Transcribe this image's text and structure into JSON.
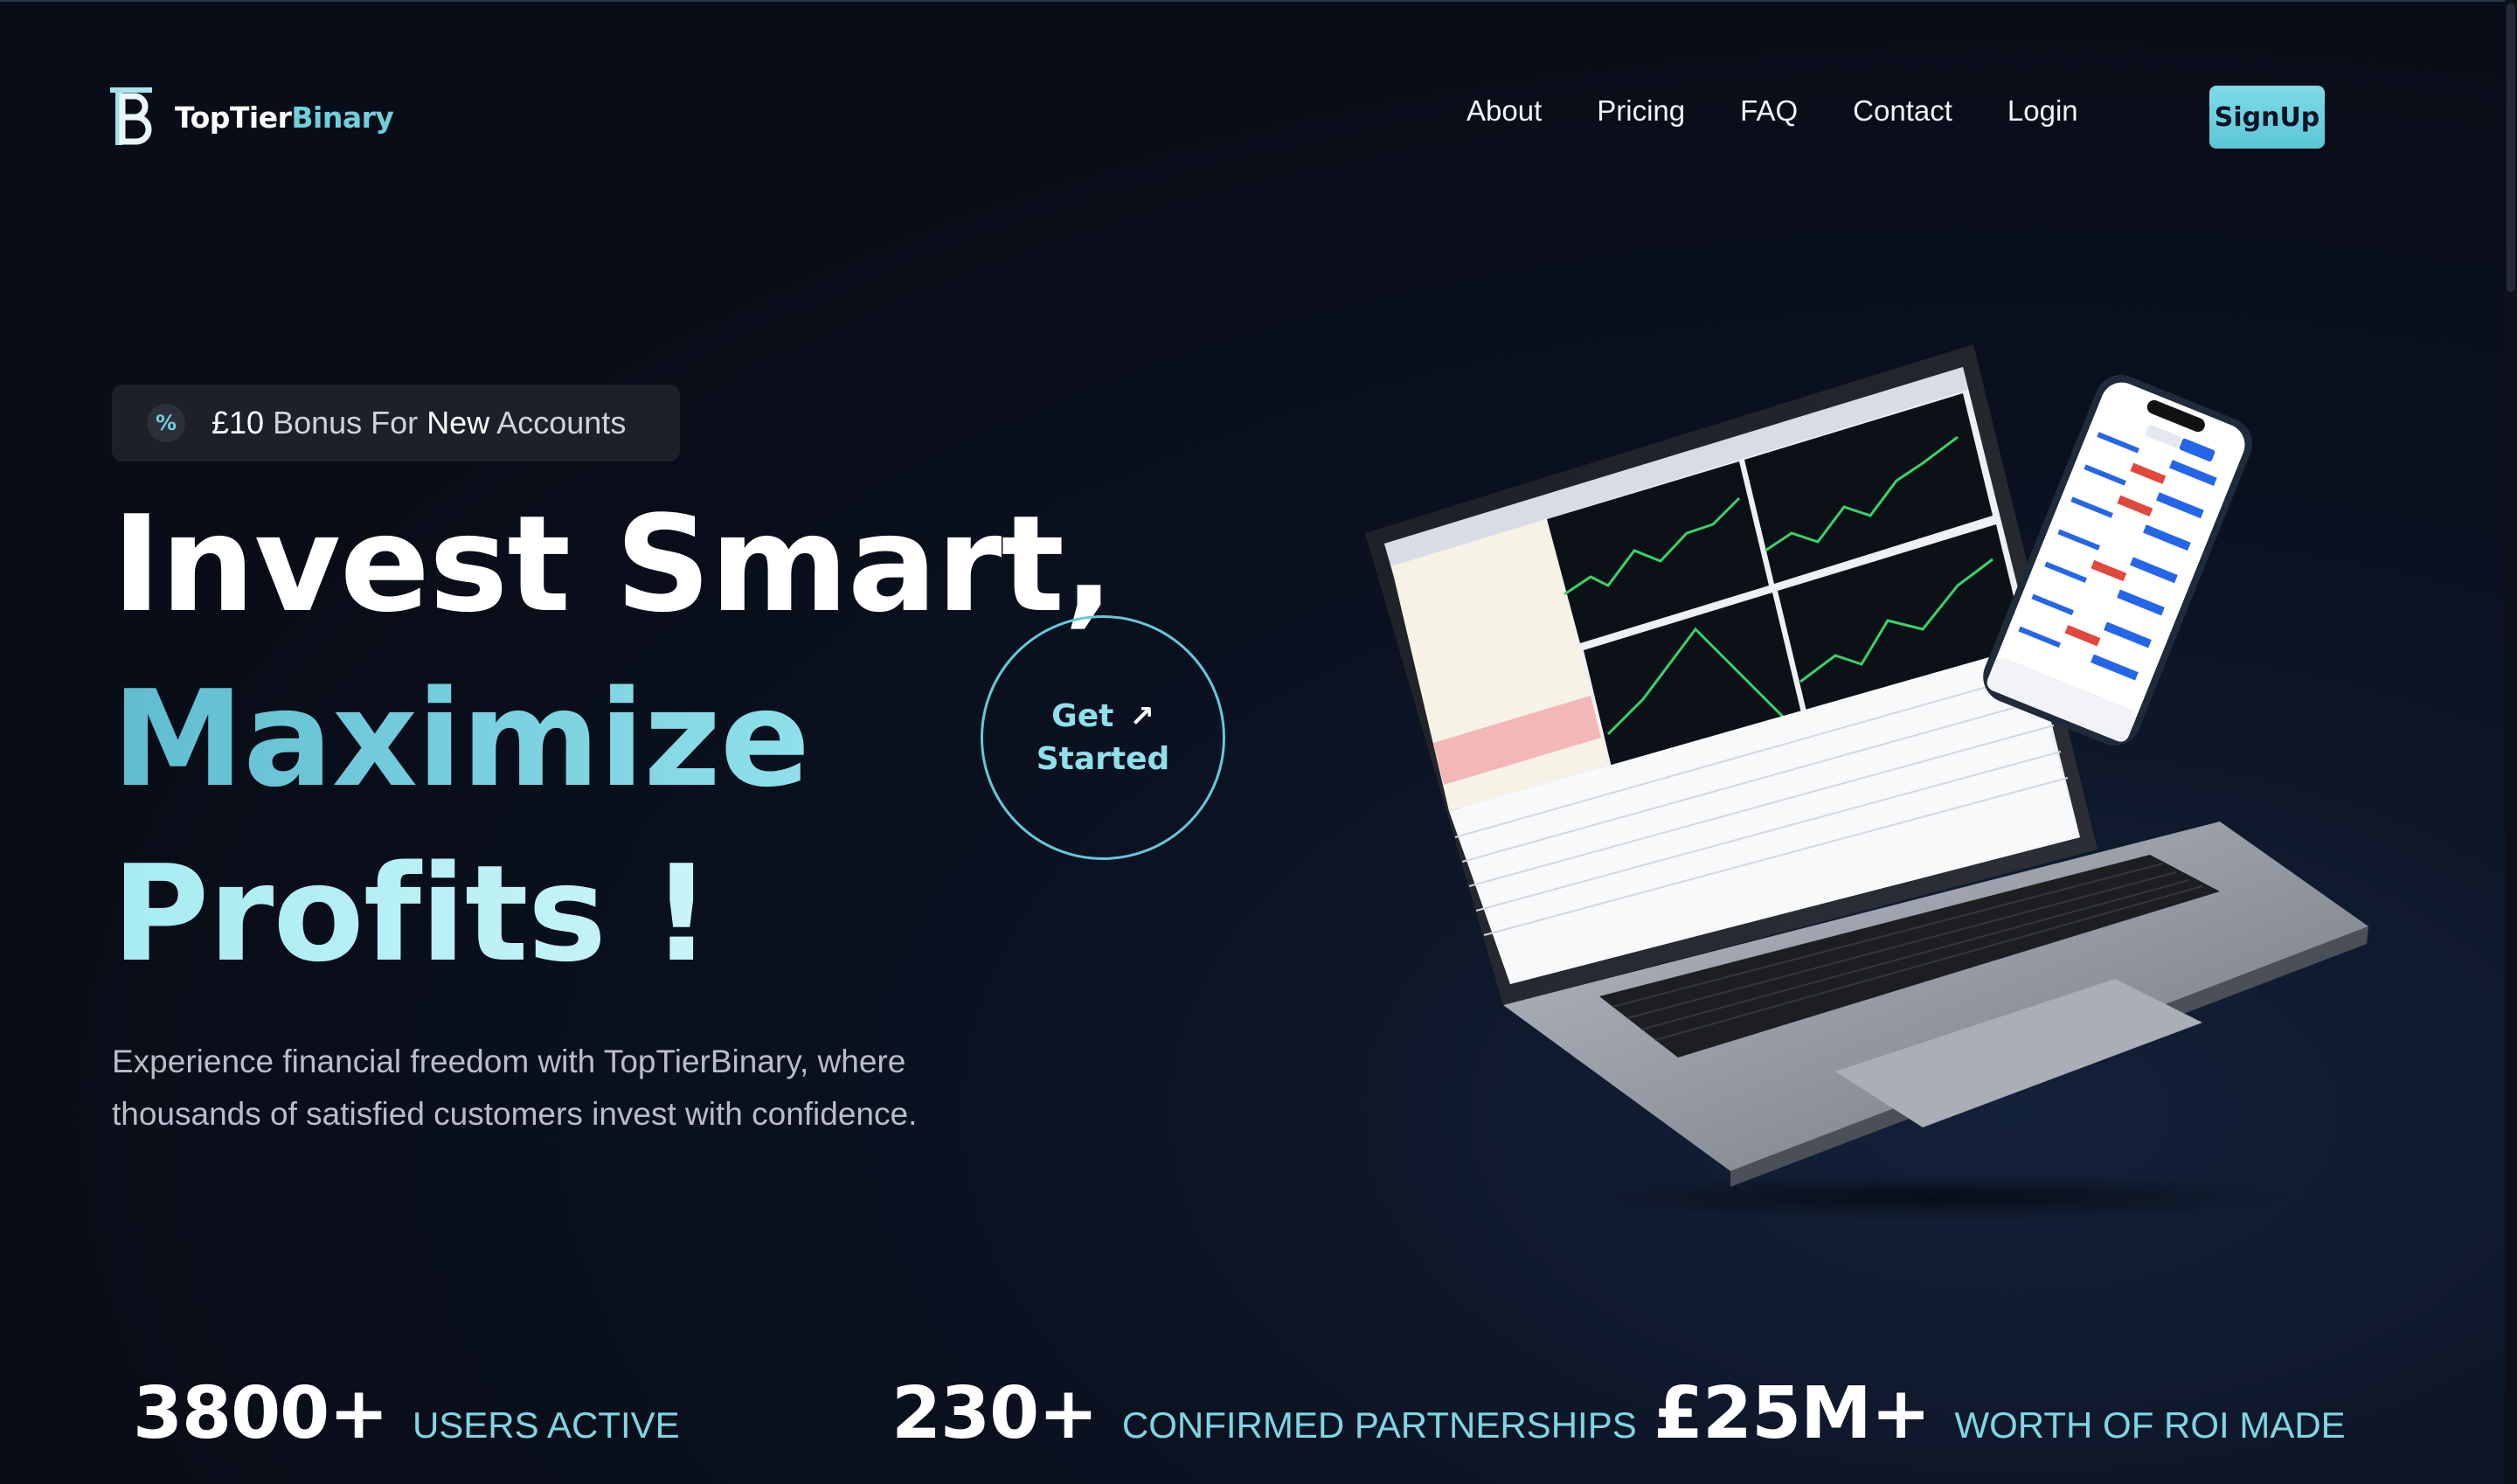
{
  "brand": {
    "name_part1": "TopTier",
    "name_part2": "Binary",
    "logo_icon": "tb-monogram-icon"
  },
  "nav": {
    "links": [
      "About",
      "Pricing",
      "FAQ",
      "Contact",
      "Login"
    ],
    "signup_label": "SignUp"
  },
  "badge": {
    "icon": "percent-icon",
    "icon_glyph": "%",
    "amount": "£10",
    "text_a": "Bonus For",
    "text_b": "New",
    "text_c": "Accounts"
  },
  "hero": {
    "line1": "Invest Smart,",
    "line2": "Maximize",
    "line3": "Profits !",
    "description": "Experience financial freedom with TopTierBinary, where thousands of satisfied customers invest with confidence."
  },
  "cta": {
    "line1": "Get",
    "line2": "Started",
    "arrow": "↗"
  },
  "stats": [
    {
      "value": "3800+",
      "label": "USERS ACTIVE"
    },
    {
      "value": "230+",
      "label": "CONFIRMED PARTNERSHIPS"
    },
    {
      "value": "£25M+",
      "label": "WORTH OF ROI MADE"
    }
  ],
  "colors": {
    "accent": "#6fd0dc",
    "background": "#0b1120",
    "signup_bg": "#6fd0dc"
  }
}
